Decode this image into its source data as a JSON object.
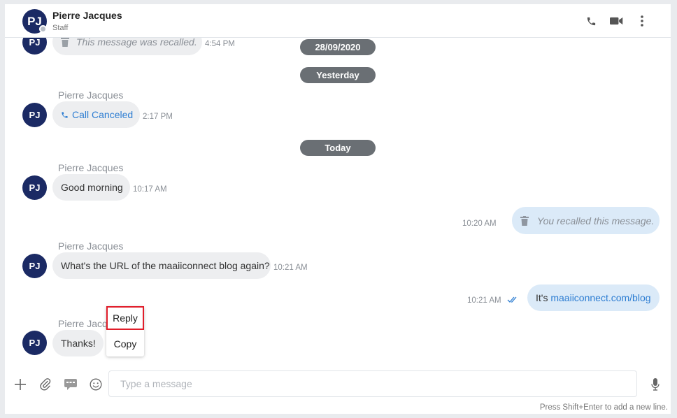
{
  "header": {
    "initials": "PJ",
    "name": "Pierre Jacques",
    "role": "Staff",
    "icons": [
      "phone-icon",
      "video-icon",
      "more-vertical-icon"
    ]
  },
  "messages": {
    "m0": {
      "avatar": "PJ",
      "text": "This message was recalled.",
      "time": "4:54 PM"
    },
    "date1": "28/09/2020",
    "date2": "Yesterday",
    "m1": {
      "avatar": "PJ",
      "sender": "Pierre Jacques",
      "text": "Call Canceled",
      "time": "2:17 PM"
    },
    "date3": "Today",
    "m2": {
      "avatar": "PJ",
      "sender": "Pierre Jacques",
      "text": "Good morning",
      "time": "10:17 AM"
    },
    "m3": {
      "text": "You recalled this message.",
      "time": "10:20 AM"
    },
    "m4": {
      "avatar": "PJ",
      "sender": "Pierre Jacques",
      "text": "What's the URL of the maaiiconnect blog again?",
      "time": "10:21 AM"
    },
    "m5": {
      "prefix": "It's ",
      "link": "maaiiconnect.com/blog",
      "time": "10:21 AM"
    },
    "m6": {
      "avatar": "PJ",
      "sender": "Pierre Jacq",
      "text": "Thanks!"
    }
  },
  "context_menu": {
    "reply": "Reply",
    "copy": "Copy"
  },
  "composer": {
    "placeholder": "Type a message",
    "hint": "Press Shift+Enter to add a new line.",
    "icons": [
      "plus-icon",
      "attachment-icon",
      "chat-template-icon",
      "emoji-icon",
      "microphone-icon"
    ]
  },
  "colors": {
    "avatar": "#1b2a64",
    "link": "#2d7dd2",
    "date_pill": "#6a6f74",
    "outgoing_bubble": "#dbeaf8",
    "highlight": "#e11d2a"
  }
}
